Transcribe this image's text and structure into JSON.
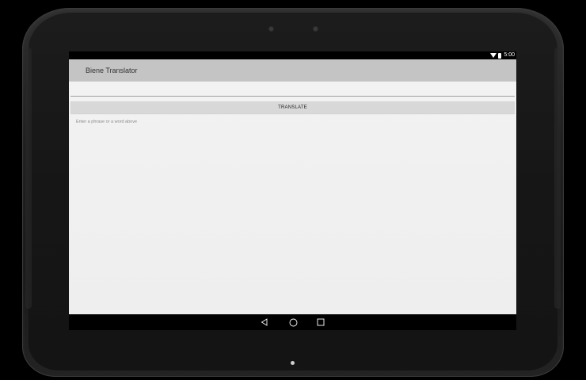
{
  "status_bar": {
    "time": "5:00",
    "wifi_icon": "wifi-icon",
    "battery_icon": "battery-icon"
  },
  "app": {
    "title": "Biene Translator"
  },
  "input": {
    "value": "",
    "placeholder": ""
  },
  "translate_button": {
    "label": "TRANSLATE"
  },
  "result": {
    "hint": "Enter a phrase or a word above"
  },
  "nav_bar": {
    "back_icon": "back-icon",
    "home_icon": "home-icon",
    "recents_icon": "recents-icon"
  },
  "colors": {
    "app_bar": "#c4c4c4",
    "button": "#d8d8d8",
    "background": "#eeeeee"
  }
}
